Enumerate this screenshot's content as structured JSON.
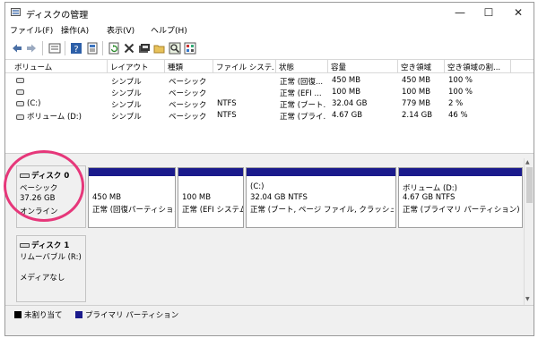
{
  "window": {
    "title": "ディスクの管理",
    "controls": {
      "minimize": "—",
      "maximize": "☐",
      "close": "✕"
    }
  },
  "menu": [
    "ファイル(F)",
    "操作(A)",
    "表示(V)",
    "ヘルプ(H)"
  ],
  "toolbar": {
    "icons": [
      "back-icon",
      "forward-icon",
      "volume-list-icon",
      "help-icon",
      "properties-icon",
      "refresh-icon",
      "delete-icon",
      "format-icon",
      "open-icon",
      "search-icon",
      "settings-icon"
    ]
  },
  "volumes": {
    "headers": [
      "ボリューム",
      "レイアウト",
      "種類",
      "ファイル システム",
      "状態",
      "容量",
      "空き領域",
      "空き領域の割..."
    ],
    "rows": [
      {
        "name": "",
        "layout": "シンプル",
        "type": "ベーシック",
        "fs": "",
        "status": "正常 (回復...",
        "capacity": "450 MB",
        "free": "450 MB",
        "pct": "100 %"
      },
      {
        "name": "",
        "layout": "シンプル",
        "type": "ベーシック",
        "fs": "",
        "status": "正常 (EFI ...",
        "capacity": "100 MB",
        "free": "100 MB",
        "pct": "100 %"
      },
      {
        "name": "(C:)",
        "layout": "シンプル",
        "type": "ベーシック",
        "fs": "NTFS",
        "status": "正常 (ブート...",
        "capacity": "32.04 GB",
        "free": "779 MB",
        "pct": "2 %"
      },
      {
        "name": "ボリューム (D:)",
        "layout": "シンプル",
        "type": "ベーシック",
        "fs": "NTFS",
        "status": "正常 (プライ...",
        "capacity": "4.67 GB",
        "free": "2.14 GB",
        "pct": "46 %"
      }
    ]
  },
  "disks": [
    {
      "name": "ディスク 0",
      "kind": "ベーシック",
      "size": "37.26 GB",
      "state": "オンライン",
      "partitions": [
        {
          "title": "",
          "size": "450 MB",
          "status": "正常 (回復パーティション)"
        },
        {
          "title": "",
          "size": "100 MB",
          "status": "正常 (EFI システム パーティション)"
        },
        {
          "title": "(C:)",
          "size": "32.04 GB NTFS",
          "status": "正常 (ブート, ページ ファイル, クラッシュ ダンプ)"
        },
        {
          "title": "ボリューム (D:)",
          "size": "4.67 GB NTFS",
          "status": "正常 (プライマリ パーティション)"
        }
      ]
    },
    {
      "name": "ディスク 1",
      "kind": "リムーバブル (R:)",
      "size": "",
      "state": "メディアなし"
    }
  ],
  "legend": [
    {
      "label": "未割り当て",
      "color": "#000000"
    },
    {
      "label": "プライマリ パーティション",
      "color": "#1a1a8c"
    }
  ],
  "colors": {
    "primary_partition": "#1a1a8c",
    "highlight_circle": "#e6377a"
  }
}
